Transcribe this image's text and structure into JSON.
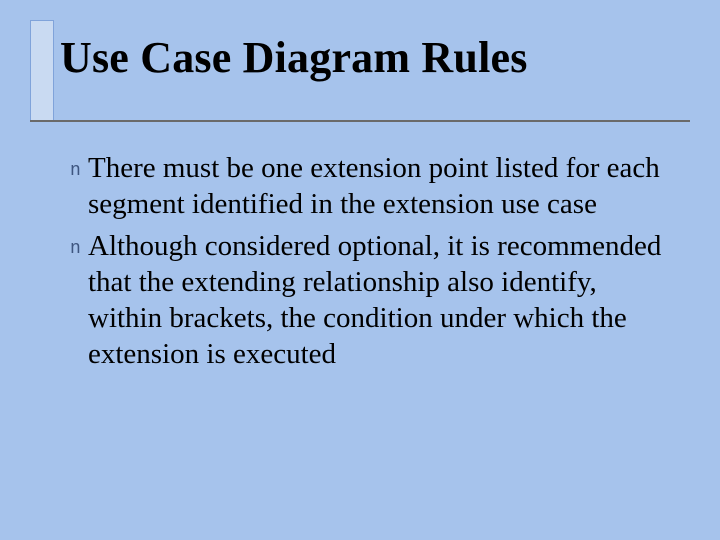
{
  "slide": {
    "title": "Use Case Diagram Rules",
    "bullet_glyph": "n",
    "items": [
      "There must be one extension point listed for each segment identified in the extension use case",
      "Although considered optional, it is recommended that the extending relationship also identify, within brackets, the condition under which the extension is executed"
    ]
  }
}
